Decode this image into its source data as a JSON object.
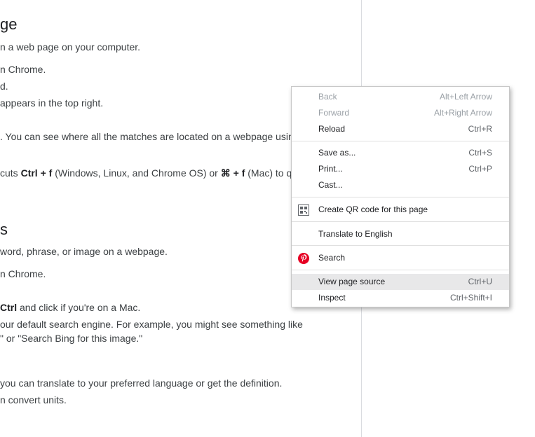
{
  "article": {
    "heading1": "ge",
    "p1": "n a web page on your computer.",
    "step1": "n Chrome.",
    "step2": "d.",
    "step3": "appears in the top right.",
    "p2": ". You can see where all the matches are located on a webpage usin",
    "shortcut_prefix": "cuts ",
    "shortcut_key1": "Ctrl + f",
    "shortcut_mid": " (Windows, Linux, and Chrome OS) or ",
    "shortcut_key2": "⌘ + f",
    "shortcut_suffix": " (Mac) to qu",
    "heading2": "s",
    "p3": "word, phrase, or image on a webpage.",
    "step4": "n Chrome.",
    "ctrl_key": "Ctrl",
    "ctrl_suffix": " and click if you're on a Mac.",
    "p4a": "our default search engine. For example, you might see something like",
    "p4b": "\" or \"Search Bing for this image.\"",
    "p5": " you can translate to your preferred language or get the definition.",
    "p6": "n convert units."
  },
  "context_menu": {
    "back": {
      "label": "Back",
      "shortcut": "Alt+Left Arrow"
    },
    "forward": {
      "label": "Forward",
      "shortcut": "Alt+Right Arrow"
    },
    "reload": {
      "label": "Reload",
      "shortcut": "Ctrl+R"
    },
    "save_as": {
      "label": "Save as...",
      "shortcut": "Ctrl+S"
    },
    "print": {
      "label": "Print...",
      "shortcut": "Ctrl+P"
    },
    "cast": {
      "label": "Cast..."
    },
    "qr_code": {
      "label": "Create QR code for this page",
      "icon": "qr-code-icon"
    },
    "translate": {
      "label": "Translate to English"
    },
    "search": {
      "label": "Search",
      "icon": "pinterest-icon",
      "icon_color": "#e60023"
    },
    "view_source": {
      "label": "View page source",
      "shortcut": "Ctrl+U"
    },
    "inspect": {
      "label": "Inspect",
      "shortcut": "Ctrl+Shift+I"
    }
  }
}
